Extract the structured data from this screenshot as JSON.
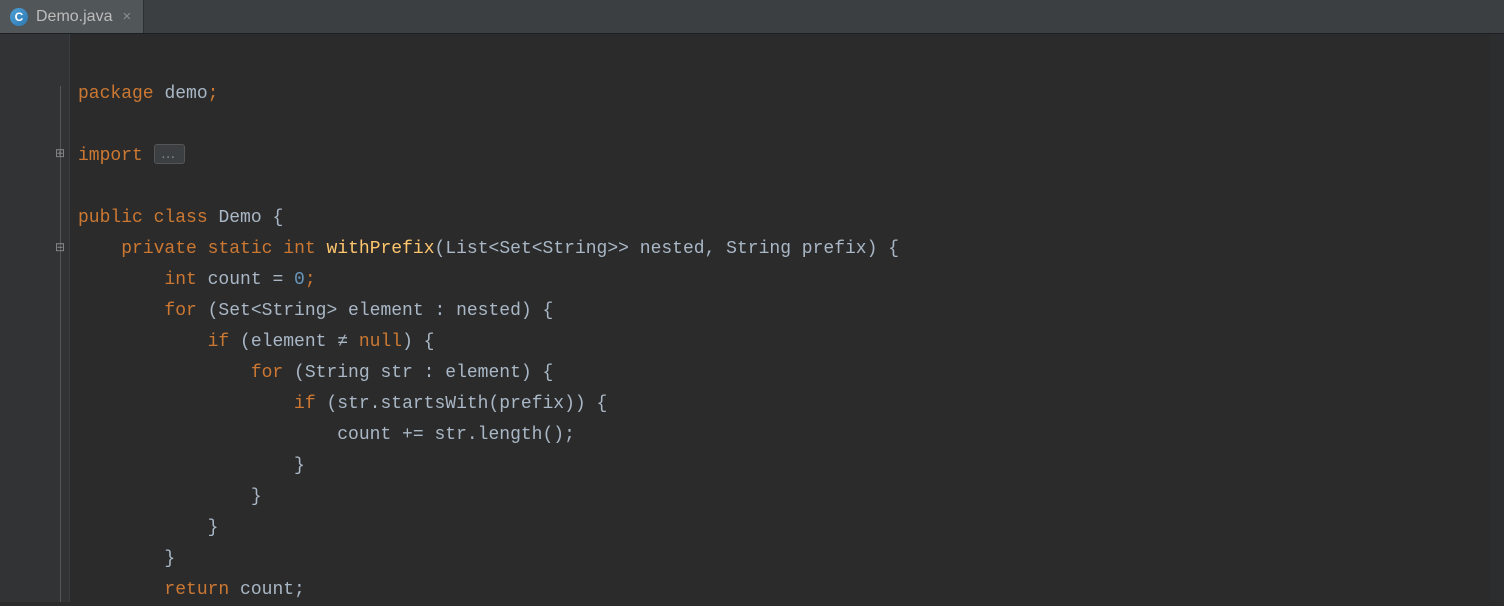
{
  "tab": {
    "icon_letter": "C",
    "filename": "Demo.java",
    "close_glyph": "×"
  },
  "fold": {
    "plus": "⊞",
    "minus": "⊟"
  },
  "code": {
    "l1": {
      "kw_package": "package",
      "pkg": "demo",
      "semi": ";"
    },
    "l3": {
      "kw_import": "import",
      "dots": "…"
    },
    "l5": {
      "kw_public": "public",
      "kw_class": "class",
      "name": "Demo",
      "brace": " {"
    },
    "l6": {
      "ind": "    ",
      "kw_private": "private",
      "kw_static": "static",
      "kw_int": "int",
      "mname": "withPrefix",
      "args": "(List<Set<String>> nested, String prefix) {"
    },
    "l7": {
      "ind": "        ",
      "kw_int": "int",
      "rest": " count = ",
      "zero": "0",
      "semi": ";"
    },
    "l8": {
      "ind": "        ",
      "kw_for": "for",
      "rest": " (Set<String> element : nested) {"
    },
    "l9": {
      "ind": "            ",
      "kw_if": "if",
      "rest1": " (element ≠ ",
      "null": "null",
      "rest2": ") {"
    },
    "l10": {
      "ind": "                ",
      "kw_for": "for",
      "rest": " (String str : element) {"
    },
    "l11": {
      "ind": "                    ",
      "kw_if": "if",
      "rest": " (str.startsWith(prefix)) {"
    },
    "l12": {
      "ind": "                        ",
      "rest": "count += str.length();"
    },
    "l13": {
      "ind": "                    ",
      "brace": "}"
    },
    "l14": {
      "ind": "                ",
      "brace": "}"
    },
    "l15": {
      "ind": "            ",
      "brace": "}"
    },
    "l16": {
      "ind": "        ",
      "brace": "}"
    },
    "l17": {
      "ind": "        ",
      "kw_return": "return",
      "rest": " count;"
    }
  }
}
